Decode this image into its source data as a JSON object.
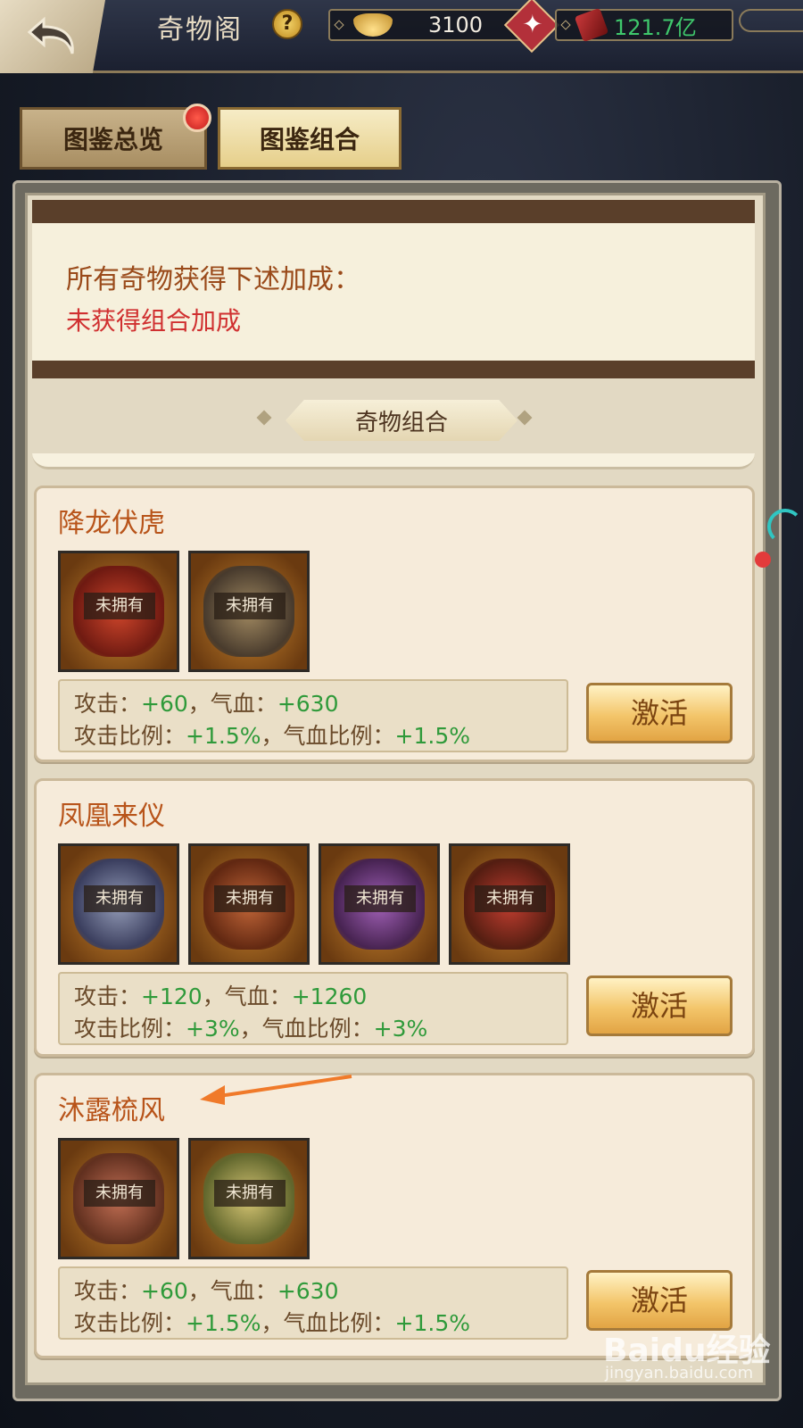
{
  "header": {
    "title": "奇物阁",
    "help_symbol": "?",
    "gold_amount": "3100",
    "power_amount": "121.7亿"
  },
  "tabs": [
    {
      "label": "图鉴总览",
      "active": false,
      "has_notification": true
    },
    {
      "label": "图鉴组合",
      "active": true
    }
  ],
  "bonus_panel": {
    "heading": "所有奇物获得下述加成：",
    "status": "未获得组合加成"
  },
  "section_title": "奇物组合",
  "combos": [
    {
      "name": "降龙伏虎",
      "items": [
        "未拥有",
        "未拥有"
      ],
      "attr_line1": {
        "atk_label": "攻击：",
        "atk": "+60",
        "sep": "，",
        "hp_label": "气血：",
        "hp": "+630"
      },
      "attr_line2": {
        "atk_label": "攻击比例：",
        "atk": "+1.5%",
        "sep": "，",
        "hp_label": "气血比例：",
        "hp": "+1.5%"
      },
      "button": "激活"
    },
    {
      "name": "凤凰来仪",
      "items": [
        "未拥有",
        "未拥有",
        "未拥有",
        "未拥有"
      ],
      "attr_line1": {
        "atk_label": "攻击：",
        "atk": "+120",
        "sep": "，",
        "hp_label": "气血：",
        "hp": "+1260"
      },
      "attr_line2": {
        "atk_label": "攻击比例：",
        "atk": "+3%",
        "sep": "，",
        "hp_label": "气血比例：",
        "hp": "+3%"
      },
      "button": "激活"
    },
    {
      "name": "沐露梳风",
      "items": [
        "未拥有",
        "未拥有"
      ],
      "attr_line1": {
        "atk_label": "攻击：",
        "atk": "+60",
        "sep": "，",
        "hp_label": "气血：",
        "hp": "+630"
      },
      "attr_line2": {
        "atk_label": "攻击比例：",
        "atk": "+1.5%",
        "sep": "，",
        "hp_label": "气血比例：",
        "hp": "+1.5%"
      },
      "button": "激活"
    }
  ],
  "watermark": {
    "logo": "Baidu经验",
    "url": "jingyan.baidu.com"
  },
  "colors": {
    "accent_green": "#3fc86c",
    "stat_green": "#2f9a3a",
    "warning_red": "#d03030",
    "title_orange": "#b8541a",
    "annotation_arrow": "#f07a2a"
  }
}
